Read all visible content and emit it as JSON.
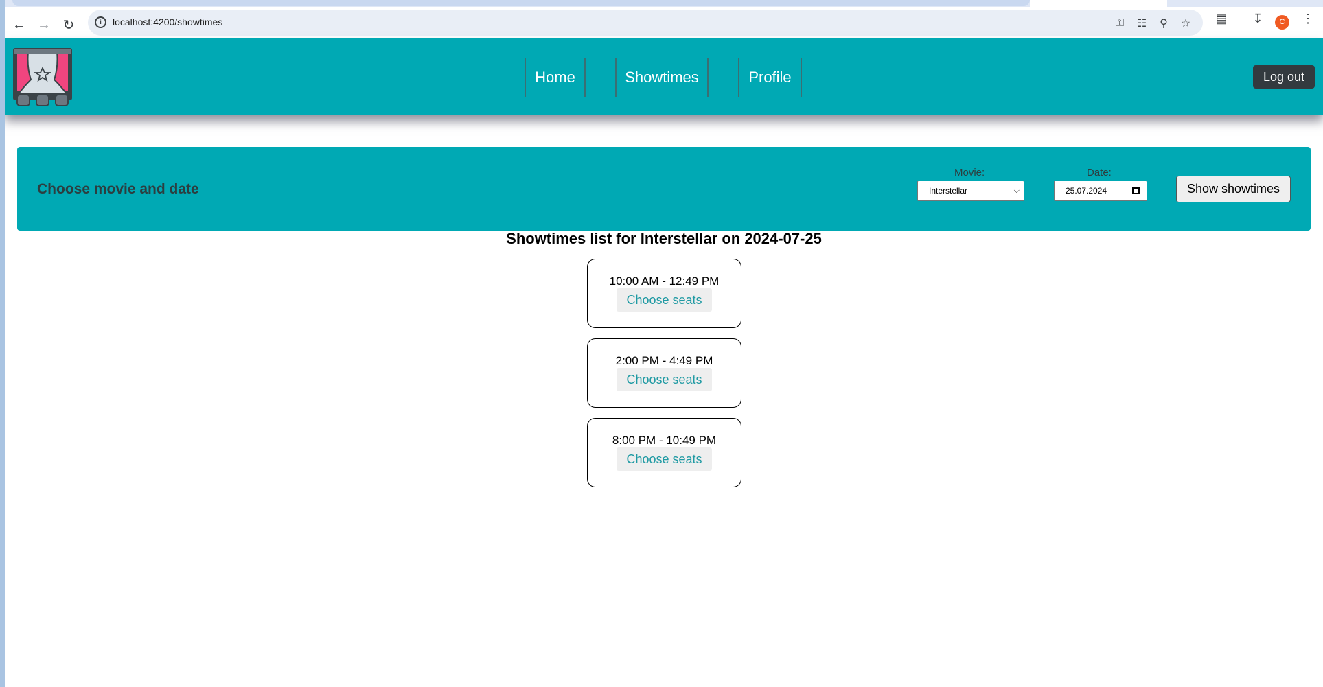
{
  "browser": {
    "url": "localhost:4200/showtimes",
    "avatar_letter": "C"
  },
  "header": {
    "nav": [
      {
        "label": "Home"
      },
      {
        "label": "Showtimes"
      },
      {
        "label": "Profile"
      }
    ],
    "logout_label": "Log out"
  },
  "filter": {
    "title": "Choose movie and date",
    "movie_label": "Movie:",
    "movie_value": "Interstellar",
    "date_label": "Date:",
    "date_value": "25.07.2024",
    "submit_label": "Show showtimes"
  },
  "showtimes": {
    "title": "Showtimes list for Interstellar on 2024-07-25",
    "items": [
      {
        "time": "10:00 AM - 12:49 PM",
        "action": "Choose seats"
      },
      {
        "time": "2:00 PM - 4:49 PM",
        "action": "Choose seats"
      },
      {
        "time": "8:00 PM - 10:49 PM",
        "action": "Choose seats"
      }
    ]
  },
  "colors": {
    "brand_teal": "#00a9b4",
    "logout_bg": "#333a3f",
    "link_teal": "#1f9aa3"
  }
}
